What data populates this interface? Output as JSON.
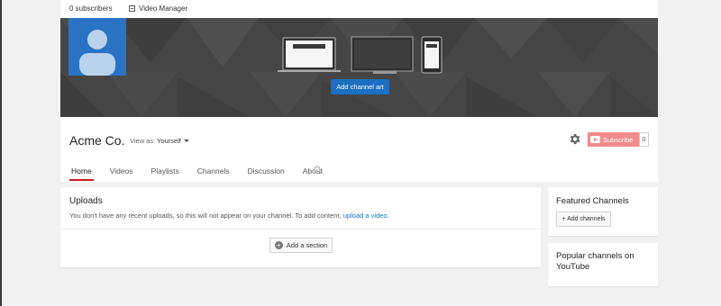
{
  "top_strip": {
    "subscribers": "0 subscribers",
    "video_manager": "Video Manager"
  },
  "banner": {
    "add_channel_art": "Add channel art"
  },
  "channel": {
    "name": "Acme Co.",
    "view_as_label": "View as:",
    "view_as_value": "Yourself",
    "subscribe_label": "Subscribe",
    "subscriber_count": "0"
  },
  "tabs": [
    "Home",
    "Videos",
    "Playlists",
    "Channels",
    "Discussion",
    "About"
  ],
  "uploads": {
    "title": "Uploads",
    "message": "You don't have any recent uploads, so this will not appear on your channel. To add content, ",
    "link": "upload a video",
    "message_end": ".",
    "add_section": "Add a section"
  },
  "featured": {
    "title": "Featured Channels",
    "add_channels": "+ Add channels"
  },
  "popular": {
    "title": "Popular channels on YouTube"
  },
  "colors": {
    "accent_blue": "#1c6fc1",
    "subscribe_red": "#f28b8b",
    "active_tab_red": "#cc181e",
    "avatar_blue": "#2a73c4"
  }
}
